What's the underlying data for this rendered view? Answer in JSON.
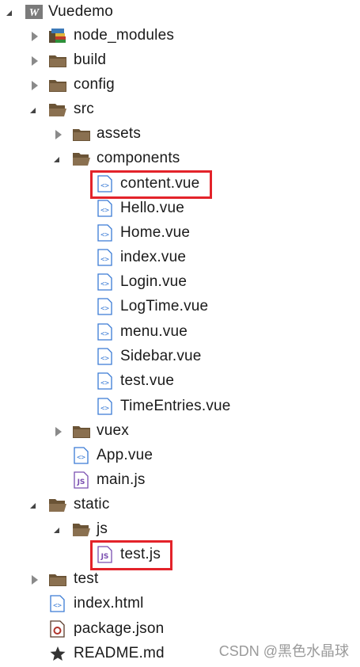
{
  "tree": {
    "project": "Vuedemo",
    "items": [
      {
        "label": "node_modules",
        "icon": "library-folder-icon",
        "state": "collapsed"
      },
      {
        "label": "build",
        "icon": "folder-icon",
        "state": "collapsed"
      },
      {
        "label": "config",
        "icon": "folder-icon",
        "state": "collapsed"
      },
      {
        "label": "src",
        "icon": "folder-open-icon",
        "state": "expanded"
      },
      {
        "label": "assets",
        "icon": "folder-icon",
        "state": "collapsed"
      },
      {
        "label": "components",
        "icon": "folder-open-icon",
        "state": "expanded"
      },
      {
        "label": "content.vue",
        "icon": "vue-file-icon"
      },
      {
        "label": "Hello.vue",
        "icon": "vue-file-icon"
      },
      {
        "label": "Home.vue",
        "icon": "vue-file-icon"
      },
      {
        "label": "index.vue",
        "icon": "vue-file-icon"
      },
      {
        "label": "Login.vue",
        "icon": "vue-file-icon"
      },
      {
        "label": "LogTime.vue",
        "icon": "vue-file-icon"
      },
      {
        "label": "menu.vue",
        "icon": "vue-file-icon"
      },
      {
        "label": "Sidebar.vue",
        "icon": "vue-file-icon"
      },
      {
        "label": "test.vue",
        "icon": "vue-file-icon"
      },
      {
        "label": "TimeEntries.vue",
        "icon": "vue-file-icon"
      },
      {
        "label": "vuex",
        "icon": "folder-icon",
        "state": "collapsed"
      },
      {
        "label": "App.vue",
        "icon": "vue-file-icon"
      },
      {
        "label": "main.js",
        "icon": "js-file-icon"
      },
      {
        "label": "static",
        "icon": "folder-open-icon",
        "state": "expanded"
      },
      {
        "label": "js",
        "icon": "folder-open-icon",
        "state": "expanded"
      },
      {
        "label": "test.js",
        "icon": "js-file-icon"
      },
      {
        "label": "test",
        "icon": "folder-icon",
        "state": "collapsed"
      },
      {
        "label": "index.html",
        "icon": "html-file-icon"
      },
      {
        "label": "package.json",
        "icon": "json-file-icon"
      },
      {
        "label": "README.md",
        "icon": "star-file-icon"
      }
    ]
  },
  "watermark": "CSDN @黑色水晶球",
  "colors": {
    "highlight": "#e3232a",
    "folder": "#6b5436",
    "vue_icon": "#3a7bd5",
    "js_icon": "#7a4fb0"
  }
}
